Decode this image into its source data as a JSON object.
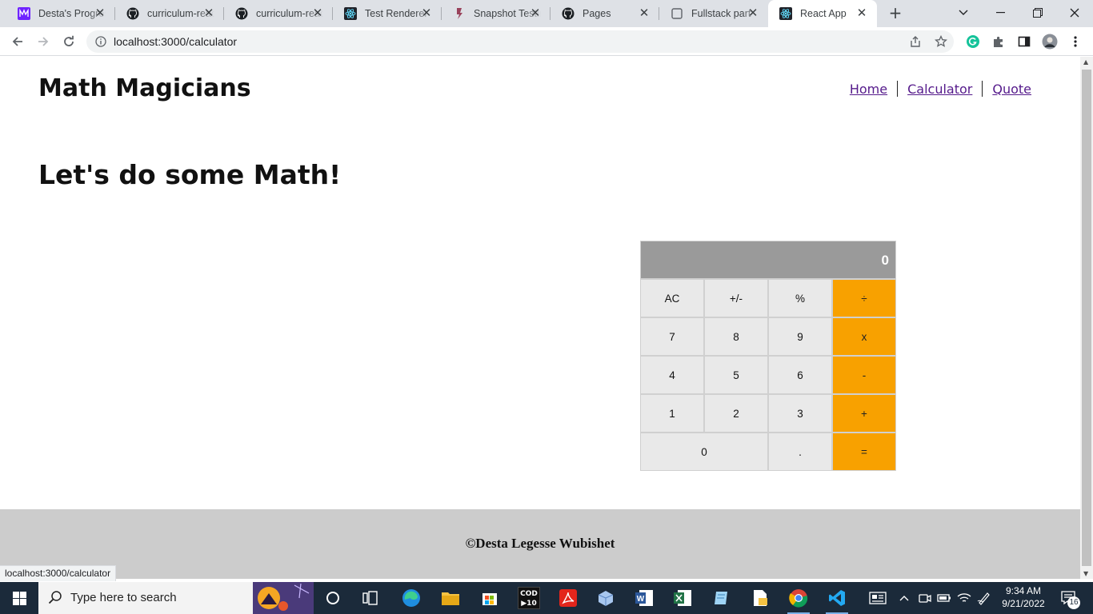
{
  "browser": {
    "tabs": [
      {
        "title": "Desta's Progress",
        "icon": "microverse-icon",
        "active": false
      },
      {
        "title": "curriculum-react",
        "icon": "github-icon",
        "active": false
      },
      {
        "title": "curriculum-react",
        "icon": "github-icon",
        "active": false
      },
      {
        "title": "Test Renderer",
        "icon": "react-icon",
        "active": false
      },
      {
        "title": "Snapshot Testing",
        "icon": "jest-icon",
        "active": false
      },
      {
        "title": "Pages",
        "icon": "github-icon",
        "active": false
      },
      {
        "title": "Fullstack part",
        "icon": "page-icon",
        "active": false
      },
      {
        "title": "React App",
        "icon": "react-icon",
        "active": true
      }
    ],
    "tab_close": "✕",
    "new_tab": "+",
    "url": "localhost:3000/calculator",
    "status_url": "localhost:3000/calculator"
  },
  "site": {
    "logo": "Math Magicians",
    "nav": [
      "Home",
      "Calculator",
      "Quote"
    ],
    "heading": "Let's do some Math!",
    "footer": "©Desta Legesse Wubishet"
  },
  "calculator": {
    "display": "0",
    "keys": [
      {
        "label": "AC",
        "op": false,
        "wide": false
      },
      {
        "label": "+/-",
        "op": false,
        "wide": false
      },
      {
        "label": "%",
        "op": false,
        "wide": false
      },
      {
        "label": "÷",
        "op": true,
        "wide": false
      },
      {
        "label": "7",
        "op": false,
        "wide": false
      },
      {
        "label": "8",
        "op": false,
        "wide": false
      },
      {
        "label": "9",
        "op": false,
        "wide": false
      },
      {
        "label": "x",
        "op": true,
        "wide": false
      },
      {
        "label": "4",
        "op": false,
        "wide": false
      },
      {
        "label": "5",
        "op": false,
        "wide": false
      },
      {
        "label": "6",
        "op": false,
        "wide": false
      },
      {
        "label": "-",
        "op": true,
        "wide": false
      },
      {
        "label": "1",
        "op": false,
        "wide": false
      },
      {
        "label": "2",
        "op": false,
        "wide": false
      },
      {
        "label": "3",
        "op": false,
        "wide": false
      },
      {
        "label": "+",
        "op": true,
        "wide": false
      },
      {
        "label": "0",
        "op": false,
        "wide": true
      },
      {
        "label": ".",
        "op": false,
        "wide": false
      },
      {
        "label": "=",
        "op": true,
        "wide": false
      }
    ]
  },
  "taskbar": {
    "search_placeholder": "Type here to search",
    "time": "9:34 AM",
    "date": "9/21/2022",
    "notifications": "16",
    "cod_label": "COD",
    "cod_badge": "▶10"
  },
  "colors": {
    "operator": "#f8a100",
    "display_bg": "#9a9a9a",
    "key_bg": "#e9e9e9",
    "footer_bg": "#cccccc",
    "taskbar_bg": "#1b2a3a"
  }
}
